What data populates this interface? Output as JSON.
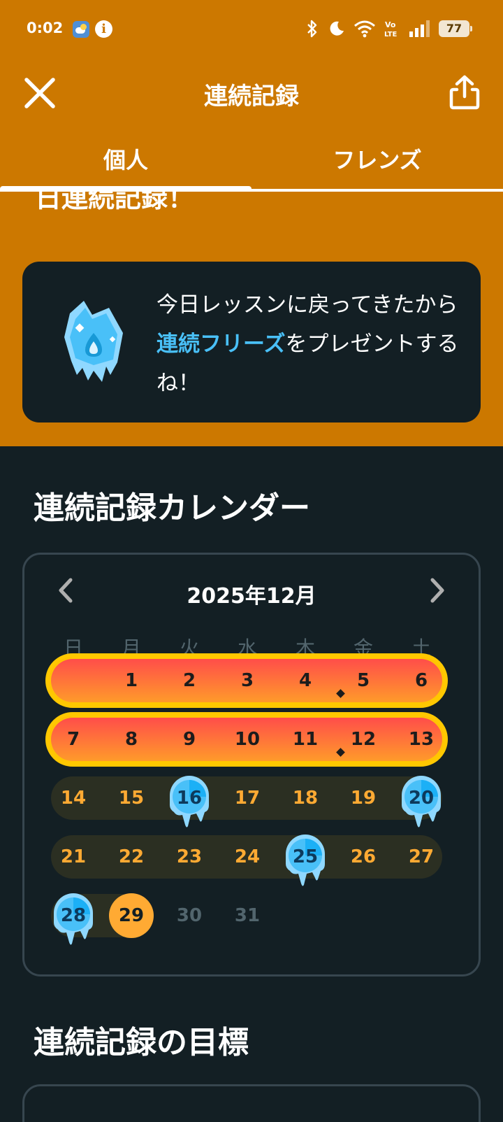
{
  "status_bar": {
    "time": "0:02",
    "battery": "77",
    "icons": [
      "weather-icon",
      "info-icon",
      "bluetooth-icon",
      "moon-icon",
      "wifi-icon",
      "volte-icon",
      "signal-icon",
      "battery-icon"
    ]
  },
  "header": {
    "title": "連続記録",
    "close_icon": "close-icon",
    "share_icon": "share-icon"
  },
  "tabs": [
    {
      "label": "個人",
      "active": true
    },
    {
      "label": "フレンズ",
      "active": false
    }
  ],
  "hero": {
    "partial_heading": "日連続記録！"
  },
  "freeze_card": {
    "icon": "streak-freeze-icon",
    "text_before": "今日レッスンに戻ってきたから",
    "highlight": "連続フリーズ",
    "text_after": "をプレゼントするね！"
  },
  "calendar_section": {
    "title": "連続記録カレンダー",
    "month": "2025年12月",
    "weekdays": [
      "日",
      "月",
      "火",
      "水",
      "木",
      "金",
      "土"
    ],
    "weeks": [
      [
        null,
        "1",
        "2",
        "3",
        "4",
        "5",
        "6"
      ],
      [
        "7",
        "8",
        "9",
        "10",
        "11",
        "12",
        "13"
      ],
      [
        "14",
        "15",
        "16",
        "17",
        "18",
        "19",
        "20"
      ],
      [
        "21",
        "22",
        "23",
        "24",
        "25",
        "26",
        "27"
      ],
      [
        "28",
        "29",
        "30",
        "31",
        null,
        null,
        null
      ]
    ],
    "streak_days": [
      "1",
      "2",
      "3",
      "4",
      "5",
      "6",
      "7",
      "8",
      "9",
      "10",
      "11",
      "12",
      "13"
    ],
    "frozen_days": [
      "16",
      "20",
      "25",
      "28"
    ],
    "today": "29",
    "colors": {
      "streak_fill_top": "#ff4b4b",
      "streak_fill_bottom": "#ff9d29",
      "streak_border": "#ffc800",
      "practiced_text": "#ffaa33",
      "freeze": "#49c0f8",
      "future_text": "#52656d"
    }
  },
  "goal_section": {
    "title": "連続記録の目標"
  }
}
